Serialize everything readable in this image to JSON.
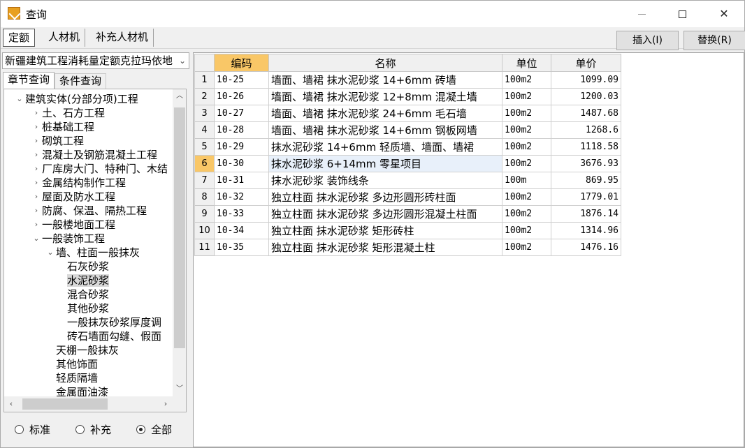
{
  "window": {
    "title": "查询"
  },
  "tabs": [
    "定额",
    "人材机",
    "补充人材机"
  ],
  "toolbar": {
    "insert_label": "插入(I)",
    "replace_label": "替换(R)"
  },
  "library": {
    "selected": "新疆建筑工程消耗量定额克拉玛依地"
  },
  "subtabs": [
    "章节查询",
    "条件查询"
  ],
  "tree": [
    {
      "label": "建筑实体(分部分项)工程",
      "expander": "⌄"
    },
    {
      "label": "土、石方工程",
      "expander": "›"
    },
    {
      "label": "桩基础工程",
      "expander": "›"
    },
    {
      "label": "砌筑工程",
      "expander": "›"
    },
    {
      "label": "混凝土及钢筋混凝土工程",
      "expander": "›"
    },
    {
      "label": "厂库房大门、特种门、木结",
      "expander": "›"
    },
    {
      "label": "金属结构制作工程",
      "expander": "›"
    },
    {
      "label": "屋面及防水工程",
      "expander": "›"
    },
    {
      "label": "防腐、保温、隔热工程",
      "expander": "›"
    },
    {
      "label": "一般楼地面工程",
      "expander": "›"
    },
    {
      "label": "一般装饰工程",
      "expander": "⌄"
    },
    {
      "label": "墙、柱面一般抹灰",
      "expander": "⌄"
    },
    {
      "label": "石灰砂浆",
      "expander": ""
    },
    {
      "label": "水泥砂浆",
      "expander": ""
    },
    {
      "label": "混合砂浆",
      "expander": ""
    },
    {
      "label": "其他砂浆",
      "expander": ""
    },
    {
      "label": "一般抹灰砂浆厚度调",
      "expander": ""
    },
    {
      "label": "砖石墙面勾缝、假面",
      "expander": ""
    },
    {
      "label": "天棚一般抹灰",
      "expander": ""
    },
    {
      "label": "其他饰面",
      "expander": ""
    },
    {
      "label": "轻质隔墙",
      "expander": ""
    },
    {
      "label": "金属面油漆",
      "expander": ""
    }
  ],
  "radios": {
    "options": [
      "标准",
      "补充",
      "全部"
    ],
    "selected": "全部"
  },
  "grid": {
    "headers": {
      "code": "编码",
      "name": "名称",
      "unit": "单位",
      "price": "单价"
    },
    "rows": [
      {
        "no": "1",
        "code": "10-25",
        "name": "墙面、墙裙 抹水泥砂浆 14+6mm 砖墙",
        "unit": "100m2",
        "price": "1099.09"
      },
      {
        "no": "2",
        "code": "10-26",
        "name": "墙面、墙裙 抹水泥砂浆 12+8mm 混凝土墙",
        "unit": "100m2",
        "price": "1200.03"
      },
      {
        "no": "3",
        "code": "10-27",
        "name": "墙面、墙裙 抹水泥砂浆 24+6mm 毛石墙",
        "unit": "100m2",
        "price": "1487.68"
      },
      {
        "no": "4",
        "code": "10-28",
        "name": "墙面、墙裙 抹水泥砂浆 14+6mm 钢板网墙",
        "unit": "100m2",
        "price": "1268.6"
      },
      {
        "no": "5",
        "code": "10-29",
        "name": "抹水泥砂浆 14+6mm 轻质墙、墙面、墙裙",
        "unit": "100m2",
        "price": "1118.58"
      },
      {
        "no": "6",
        "code": "10-30",
        "name": "抹水泥砂浆 6+14mm 零星项目",
        "unit": "100m2",
        "price": "3676.93"
      },
      {
        "no": "7",
        "code": "10-31",
        "name": "抹水泥砂浆 装饰线条",
        "unit": "100m",
        "price": "869.95"
      },
      {
        "no": "8",
        "code": "10-32",
        "name": "独立柱面 抹水泥砂浆 多边形圆形砖柱面",
        "unit": "100m2",
        "price": "1779.01"
      },
      {
        "no": "9",
        "code": "10-33",
        "name": "独立柱面 抹水泥砂浆 多边形圆形混凝土柱面",
        "unit": "100m2",
        "price": "1876.14"
      },
      {
        "no": "10",
        "code": "10-34",
        "name": "独立柱面 抹水泥砂浆 矩形砖柱",
        "unit": "100m2",
        "price": "1314.96"
      },
      {
        "no": "11",
        "code": "10-35",
        "name": "独立柱面 抹水泥砂浆 矩形混凝土柱",
        "unit": "100m2",
        "price": "1476.16"
      }
    ]
  }
}
